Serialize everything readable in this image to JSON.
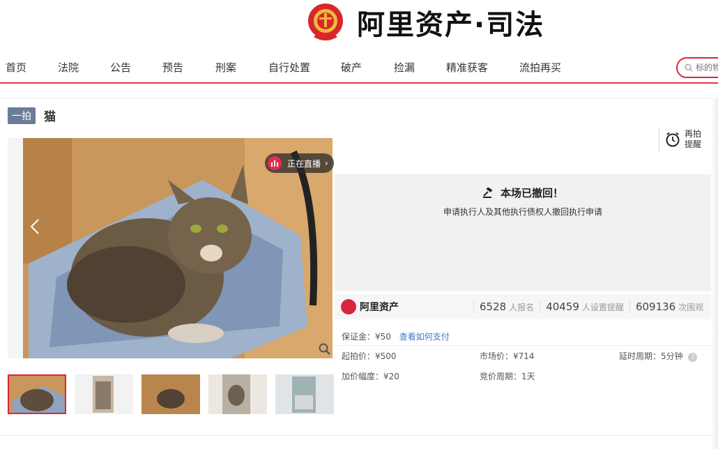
{
  "header": {
    "logo_text": "阿里资产·司法",
    "nav": [
      "首页",
      "法院",
      "公告",
      "预告",
      "刑案",
      "自行处置",
      "破产",
      "捡漏",
      "精准获客",
      "流拍再买"
    ],
    "search_placeholder": "标的物"
  },
  "item": {
    "tag": "一拍",
    "title": "猫",
    "live_badge": "正在直播",
    "thumbnail_count": 5,
    "active_thumbnail": 1
  },
  "remind": {
    "label": "再拍提醒"
  },
  "status": {
    "title": "本场已撤回！",
    "subtitle": "申请执行人及其他执行债权人撤回执行申请"
  },
  "stats": {
    "brand": "阿里资产",
    "signups_num": "6528",
    "signups_label": "人报名",
    "reminders_num": "40459",
    "reminders_label": "人设置提醒",
    "views_num": "609136",
    "views_label": "次围观"
  },
  "details": {
    "deposit": "保证金：¥50",
    "pay_link": "查看如何支付",
    "start_price": "起拍价：¥500",
    "market_price": "市场价：¥714",
    "delay_period": "延时周期：5分钟",
    "increment": "加价幅度：¥20",
    "bid_period": "竞价周期：1天"
  },
  "colors": {
    "accent": "#e5323f",
    "link": "#3b79c9",
    "tag": "#6b7c99"
  }
}
